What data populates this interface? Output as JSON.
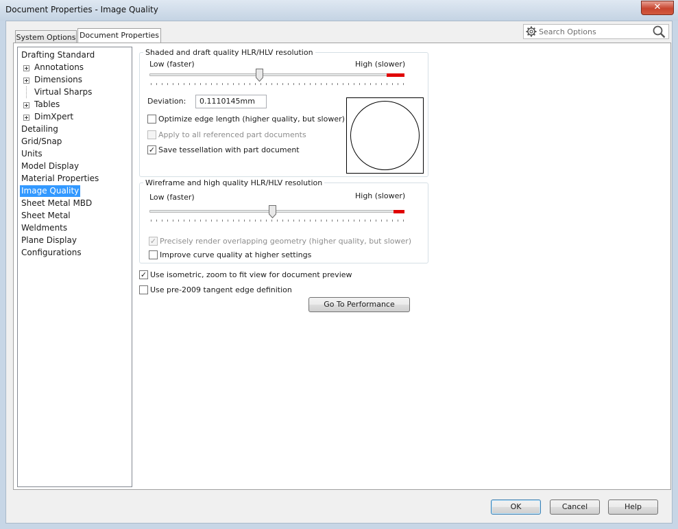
{
  "window": {
    "title": "Document Properties - Image Quality",
    "close_glyph": "✕"
  },
  "tabs": [
    {
      "label": "System Options"
    },
    {
      "label": "Document Properties"
    }
  ],
  "search": {
    "placeholder": "Search Options"
  },
  "tree": {
    "items": [
      {
        "label": "Drafting Standard",
        "expandable": false,
        "child": false
      },
      {
        "label": "Annotations",
        "expandable": true,
        "child": true
      },
      {
        "label": "Dimensions",
        "expandable": true,
        "child": true
      },
      {
        "label": "Virtual Sharps",
        "expandable": false,
        "child": true
      },
      {
        "label": "Tables",
        "expandable": true,
        "child": true
      },
      {
        "label": "DimXpert",
        "expandable": true,
        "child": true
      },
      {
        "label": "Detailing",
        "expandable": false,
        "child": false
      },
      {
        "label": "Grid/Snap",
        "expandable": false,
        "child": false
      },
      {
        "label": "Units",
        "expandable": false,
        "child": false
      },
      {
        "label": "Model Display",
        "expandable": false,
        "child": false
      },
      {
        "label": "Material Properties",
        "expandable": false,
        "child": false
      },
      {
        "label": "Image Quality",
        "expandable": false,
        "child": false,
        "selected": true
      },
      {
        "label": "Sheet Metal MBD",
        "expandable": false,
        "child": false
      },
      {
        "label": "Sheet Metal",
        "expandable": false,
        "child": false
      },
      {
        "label": "Weldments",
        "expandable": false,
        "child": false
      },
      {
        "label": "Plane Display",
        "expandable": false,
        "child": false
      },
      {
        "label": "Configurations",
        "expandable": false,
        "child": false
      }
    ]
  },
  "shaded": {
    "title": "Shaded and draft quality HLR/HLV resolution",
    "low_label": "Low (faster)",
    "high_label": "High (slower)",
    "slider_value": 0.43,
    "deviation_label": "Deviation:",
    "deviation_value": "0.1110145mm",
    "optimize_label": "Optimize edge length (higher quality, but slower)",
    "optimize_checked": false,
    "apply_label": "Apply to all referenced part documents",
    "apply_checked": false,
    "save_label": "Save tessellation with part document",
    "save_checked": true
  },
  "wireframe": {
    "title": "Wireframe and high quality HLR/HLV resolution",
    "low_label": "Low (faster)",
    "high_label": "High (slower)",
    "slider_value": 0.48,
    "precise_label": "Precisely render overlapping geometry (higher quality, but slower)",
    "precise_checked": true,
    "improve_label": "Improve curve quality at higher settings",
    "improve_checked": false
  },
  "isometric": {
    "label": "Use isometric, zoom to fit view for document preview",
    "checked": true
  },
  "pre2009": {
    "label": "Use pre-2009 tangent edge definition",
    "checked": false
  },
  "buttons": {
    "performance": "Go To Performance",
    "ok": "OK",
    "cancel": "Cancel",
    "help": "Help"
  },
  "check_glyph": "✓"
}
